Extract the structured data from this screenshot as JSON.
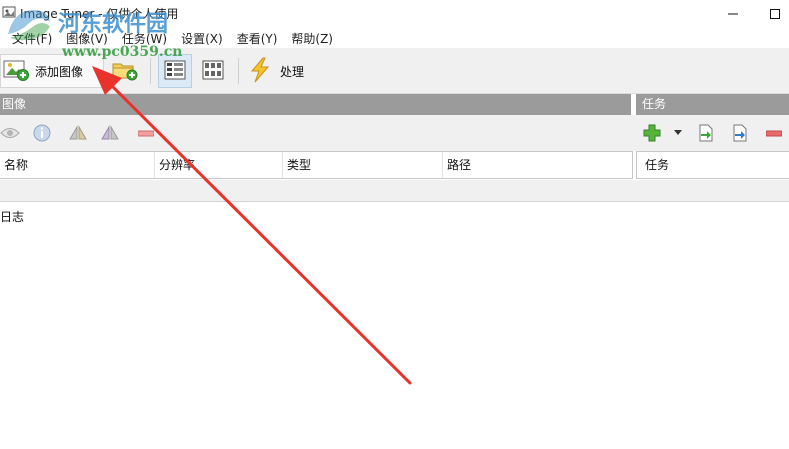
{
  "window": {
    "title": "Image Tuner - 仅供个人使用"
  },
  "watermark": {
    "text": "河东软件园",
    "url": "www.pc0359.cn"
  },
  "menu": [
    {
      "label": "文件(F)"
    },
    {
      "label": "图像(V)"
    },
    {
      "label": "任务(W)"
    },
    {
      "label": "设置(X)"
    },
    {
      "label": "查看(Y)"
    },
    {
      "label": "帮助(Z)"
    }
  ],
  "toolbar": {
    "add_image_label": "添加图像",
    "process_label": "处理"
  },
  "images_panel": {
    "header": "图像",
    "columns": [
      "名称",
      "分辨率",
      "类型",
      "路径"
    ]
  },
  "tasks_panel": {
    "header": "任务",
    "columns": [
      "任务"
    ]
  },
  "log": {
    "label": "日志"
  },
  "colors": {
    "panel_header_bg": "#9b9b9b",
    "toolbar_bg": "#f0f0f0",
    "annotation_arrow": "#e8322b",
    "watermark_blue": "#3a8fd0",
    "watermark_green": "#2e9a3a"
  },
  "icons": {
    "app": "image-tuner-app-icon",
    "add_image": "add-image-icon",
    "add_folder": "add-folder-icon",
    "view_list": "view-list-icon",
    "view_thumbnails": "view-thumbnails-icon",
    "process": "lightning-icon",
    "preview": "eye-icon",
    "info": "info-icon",
    "flip": "flip-icon",
    "mirror": "mirror-icon",
    "remove": "remove-icon",
    "add_task": "plus-icon",
    "import_task": "import-icon",
    "export_task": "export-icon",
    "delete_task": "remove-icon"
  }
}
